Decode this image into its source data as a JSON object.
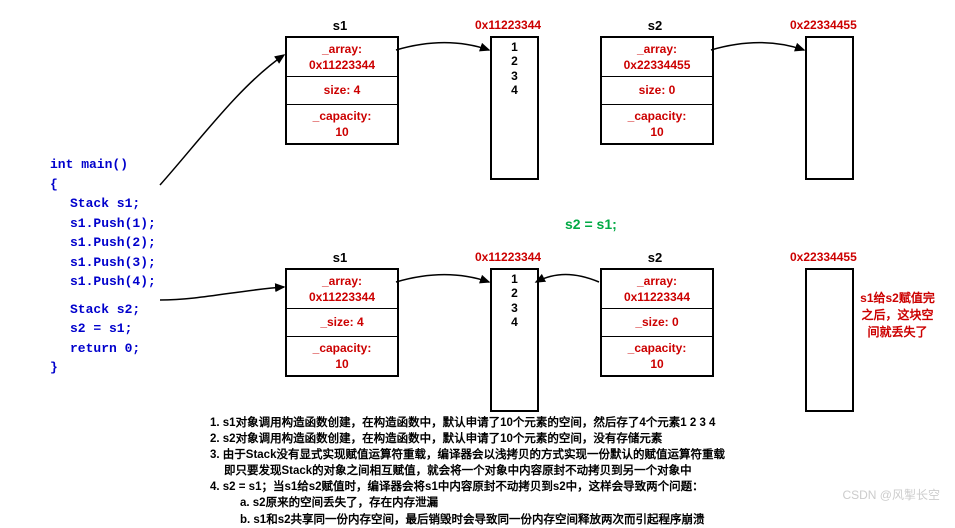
{
  "code": {
    "line1": "int main()",
    "line2": "{",
    "line3": "Stack s1;",
    "line4": "s1.Push(1);",
    "line5": "s1.Push(2);",
    "line6": "s1.Push(3);",
    "line7": "s1.Push(4);",
    "line8": "Stack s2;",
    "line9": "s2 = s1;",
    "line10": "return 0;",
    "line11": "}"
  },
  "top": {
    "s1": {
      "label": "s1",
      "array_label": "_array:",
      "array_val": "0x11223344",
      "size": "size: 4",
      "capacity_label": "_capacity:",
      "capacity_val": "10"
    },
    "mem1": {
      "addr": "0x11223344",
      "items": "1\n2\n3\n4"
    },
    "s2": {
      "label": "s2",
      "array_label": "_array:",
      "array_val": "0x22334455",
      "size": "size: 0",
      "capacity_label": "_capacity:",
      "capacity_val": "10"
    },
    "mem2": {
      "addr": "0x22334455"
    }
  },
  "assign_text": "s2 = s1;",
  "bottom": {
    "s1": {
      "label": "s1",
      "array_label": "_array:",
      "array_val": "0x11223344",
      "size": "_size: 4",
      "capacity_label": "_capacity:",
      "capacity_val": "10"
    },
    "mem1": {
      "addr": "0x11223344",
      "items": "1\n2\n3\n4"
    },
    "s2": {
      "label": "s2",
      "array_label": "_array:",
      "array_val": "0x11223344",
      "size": "_size: 0",
      "capacity_label": "_capacity:",
      "capacity_val": "10"
    },
    "mem2": {
      "addr": "0x22334455"
    },
    "note": "s1给s2赋值完之后，这块空间就丢失了"
  },
  "footer": {
    "l1": "1. s1对象调用构造函数创建，在构造函数中，默认申请了10个元素的空间，然后存了4个元素1 2 3 4",
    "l2": "2. s2对象调用构造函数创建，在构造函数中，默认申请了10个元素的空间，没有存储元素",
    "l3": "3. 由于Stack没有显式实现赋值运算符重载，编译器会以浅拷贝的方式实现一份默认的赋值运算符重载",
    "l3b": "即只要发现Stack的对象之间相互赋值，就会将一个对象中内容原封不动拷贝到另一个对象中",
    "l4": "4. s2 = s1；当s1给s2赋值时，编译器会将s1中内容原封不动拷贝到s2中，这样会导致两个问题：",
    "l4a": "a. s2原来的空间丢失了，存在内存泄漏",
    "l4b": "b. s1和s2共享同一份内存空间，最后销毁时会导致同一份内存空间释放两次而引起程序崩溃"
  },
  "watermark": "CSDN @风掣长空"
}
